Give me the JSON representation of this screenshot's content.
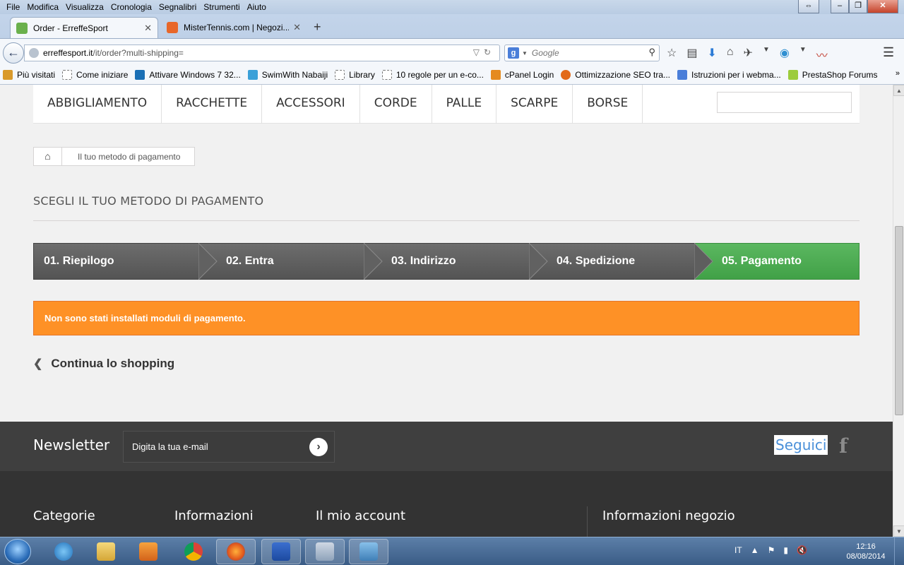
{
  "browser": {
    "menu": [
      "File",
      "Modifica",
      "Visualizza",
      "Cronologia",
      "Segnalibri",
      "Strumenti",
      "Aiuto"
    ],
    "tabs": [
      {
        "title": "Order - ErreffeSport",
        "active": true,
        "favicon_color": "#6ab04c"
      },
      {
        "title": "MisterTennis.com | Negozi...",
        "active": false,
        "favicon_color": "#e8672a"
      }
    ],
    "url_host": "erreffesport.it",
    "url_path": "/it/order?multi-shipping=",
    "search_placeholder": "Google",
    "bookmarks": [
      {
        "label": "Più visitati",
        "icon": "bookmark-folder-icon",
        "color": "#d99a2b"
      },
      {
        "label": "Come iniziare",
        "icon": "page-icon",
        "color": "#ffffff"
      },
      {
        "label": "Attivare Windows 7 32...",
        "icon": "site-icon",
        "color": "#1a6fb5"
      },
      {
        "label": "SwimWith Nabaiji",
        "icon": "site-icon",
        "color": "#3aa0d8"
      },
      {
        "label": "Library",
        "icon": "page-icon",
        "color": "#ffffff"
      },
      {
        "label": "10 regole per un e-co...",
        "icon": "page-icon",
        "color": "#ffffff"
      },
      {
        "label": "cPanel Login",
        "icon": "cpanel-icon",
        "color": "#e58a1f"
      },
      {
        "label": "Ottimizzazione SEO tra...",
        "icon": "site-icon",
        "color": "#e26a1a"
      },
      {
        "label": "Istruzioni per i webma...",
        "icon": "google-icon",
        "color": "#4a7ed9"
      },
      {
        "label": "PrestaShop Forums",
        "icon": "prestashop-icon",
        "color": "#9ccc3c"
      }
    ]
  },
  "site": {
    "nav": [
      "ABBIGLIAMENTO",
      "RACCHETTE",
      "ACCESSORI",
      "CORDE",
      "PALLE",
      "SCARPE",
      "BORSE"
    ],
    "breadcrumb": "Il tuo metodo di pagamento",
    "page_title": "SCEGLI IL TUO METODO DI PAGAMENTO",
    "steps": [
      {
        "label": "01. Riepilogo",
        "state": "inactive"
      },
      {
        "label": "02. Entra",
        "state": "inactive"
      },
      {
        "label": "03. Indirizzo",
        "state": "inactive"
      },
      {
        "label": "04. Spedizione",
        "state": "inactive"
      },
      {
        "label": "05. Pagamento",
        "state": "current"
      }
    ],
    "alert": "Non sono stati installati moduli di pagamento.",
    "continue": "Continua lo shopping",
    "newsletter": {
      "title": "Newsletter",
      "placeholder": "Digita la tua e-mail"
    },
    "social": {
      "label": "Seguici"
    },
    "footer": [
      "Categorie",
      "Informazioni",
      "Il mio account",
      "Informazioni negozio"
    ],
    "colors": {
      "step_done": "#46a74e",
      "step_inactive": "#5f5f5f",
      "alert": "#fe9126"
    }
  },
  "taskbar": {
    "language": "IT",
    "time": "12:16",
    "date": "08/08/2014"
  }
}
